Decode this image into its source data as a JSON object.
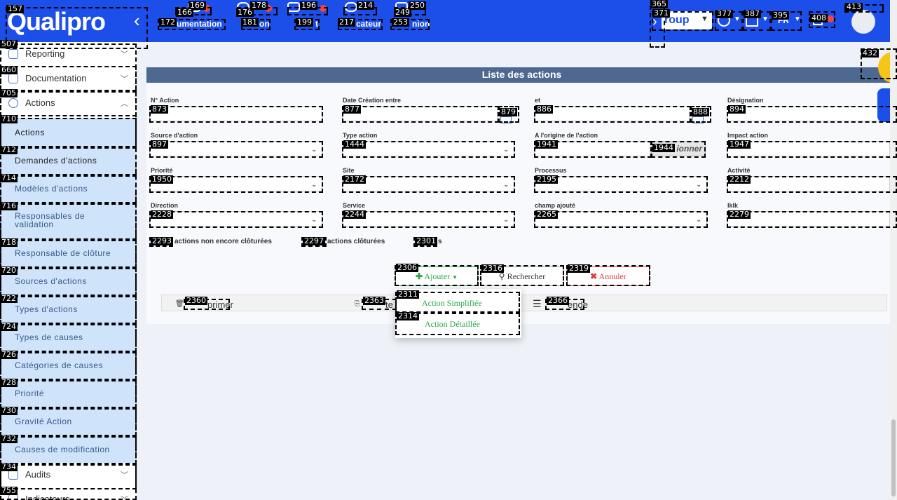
{
  "app": {
    "logo_text": "Qualipro",
    "brand_color": "#1c4eea",
    "accent_yellow": "#f5c518"
  },
  "topnav": {
    "items": [
      {
        "label": "umentation",
        "icon": "document-icon"
      },
      {
        "label": "on",
        "icon": "action-icon"
      },
      {
        "label": "t",
        "icon": "audit-icon"
      },
      {
        "label": "cateur",
        "icon": "indicator-icon"
      },
      {
        "label": "nion",
        "icon": "meeting-icon"
      }
    ],
    "group_select": "roup",
    "language": "FR"
  },
  "sidebar": {
    "top_items": [
      {
        "label": "Reporting",
        "icon": "chart-icon"
      },
      {
        "label": "Documentation",
        "icon": "document-icon"
      },
      {
        "label": "Actions",
        "icon": "action-icon"
      }
    ],
    "sub_items": [
      {
        "label": "Actions"
      },
      {
        "label": "Demandes d'actions"
      },
      {
        "label": "Modèles d'actions"
      },
      {
        "label": "Responsables de validation"
      },
      {
        "label": "Responsable de clôture"
      },
      {
        "label": "Sources d'actions"
      },
      {
        "label": "Types d'actions"
      },
      {
        "label": "Types de causes"
      },
      {
        "label": "Catégories de causes"
      },
      {
        "label": "Priorité"
      },
      {
        "label": "Gravité Action"
      },
      {
        "label": "Causes de modification"
      }
    ],
    "bottom_items": [
      {
        "label": "Audits",
        "icon": "audit-icon"
      },
      {
        "label": "Indicateurs",
        "icon": "indicator-icon"
      }
    ]
  },
  "main": {
    "title": "Liste des actions",
    "fields": {
      "num_action": "N° Action",
      "date_creation": "Date Création entre",
      "et": "et",
      "designation": "Désignation",
      "source_action": "Source d'action",
      "type_action": "Type action",
      "origine_action": "A l'origine de l'action",
      "impact_action": "Impact action",
      "priorite": "Priorité",
      "site": "Site",
      "processus": "Processus",
      "activite": "Activité",
      "direction": "Direction",
      "service": "Service",
      "champ_ajoute": "champ ajouté",
      "lklk": "lklk",
      "selectionner_btn": "ionner"
    },
    "radios": {
      "non_cloturees": "actions non encore clôturées",
      "cloturees": "actions clôturées",
      "toutes": "s"
    },
    "buttons": {
      "ajouter": "Ajouter",
      "rechercher": "Rechercher",
      "annuler": "Annuler"
    },
    "toolbar": {
      "supprimer": "primer",
      "exporter": "te",
      "legende": "ende"
    },
    "dropdown": {
      "simplifiee": "Action Simplifiée",
      "detaillee": "Action Détaillée"
    }
  },
  "overlay_ids": [
    "157",
    "169",
    "166",
    "172",
    "176",
    "178",
    "181",
    "196",
    "199",
    "214",
    "217",
    "249",
    "250",
    "253",
    "365",
    "371",
    "377",
    "387",
    "395",
    "408",
    "413",
    "432",
    "507",
    "660",
    "705",
    "710",
    "712",
    "714",
    "716",
    "718",
    "720",
    "722",
    "724",
    "726",
    "728",
    "730",
    "732",
    "734",
    "755",
    "873",
    "877",
    "879",
    "886",
    "888",
    "894",
    "897",
    "1444",
    "1941",
    "1944",
    "1947",
    "1950",
    "2172",
    "2195",
    "2212",
    "2228",
    "2244",
    "2265",
    "2279",
    "2293",
    "2297",
    "2301",
    "2306",
    "2311",
    "2314",
    "2316",
    "2319",
    "2360",
    "2363",
    "2366"
  ]
}
